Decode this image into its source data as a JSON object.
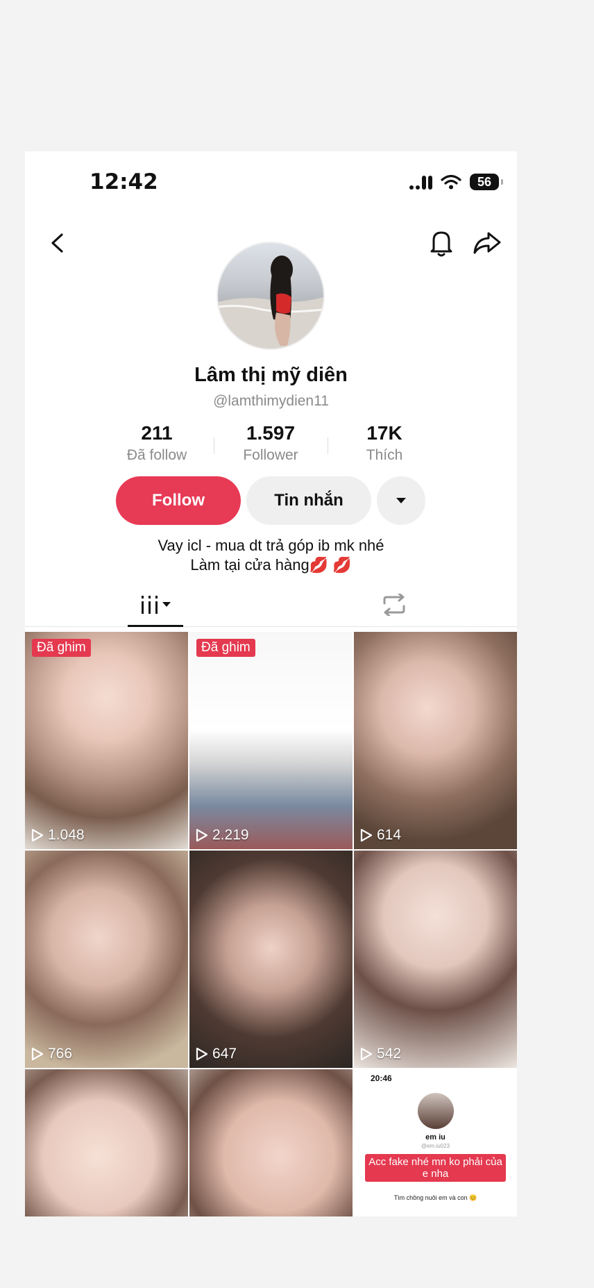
{
  "status_bar": {
    "time": "12:42",
    "battery": "56"
  },
  "profile": {
    "name": "Lâm thị mỹ diên",
    "handle": "@lamthimydien11",
    "stats": [
      {
        "value": "211",
        "label": "Đã follow"
      },
      {
        "value": "1.597",
        "label": "Follower"
      },
      {
        "value": "17K",
        "label": "Thích"
      }
    ],
    "follow_label": "Follow",
    "message_label": "Tin nhắn",
    "bio_line1": "Vay icl - mua dt trả góp ib mk nhé",
    "bio_line2": "Làm tại cửa hàng💋 💋"
  },
  "videos": [
    {
      "pinned": "Đã ghim",
      "views": "1.048"
    },
    {
      "pinned": "Đã ghim",
      "views": "2.219"
    },
    {
      "views": "614"
    },
    {
      "views": "766"
    },
    {
      "views": "647"
    },
    {
      "views": "542"
    },
    {},
    {},
    {
      "sub_time": "20:46",
      "sub_name": "em iu",
      "sub_handle": "@em.iu023",
      "sub_text": "Acc fake nhé mn ko phải của e nha",
      "sub_bio": "Tìm chồng nuôi em và con 😊"
    }
  ],
  "colors": {
    "accent": "#e73a55",
    "pin": "#e4394f"
  }
}
